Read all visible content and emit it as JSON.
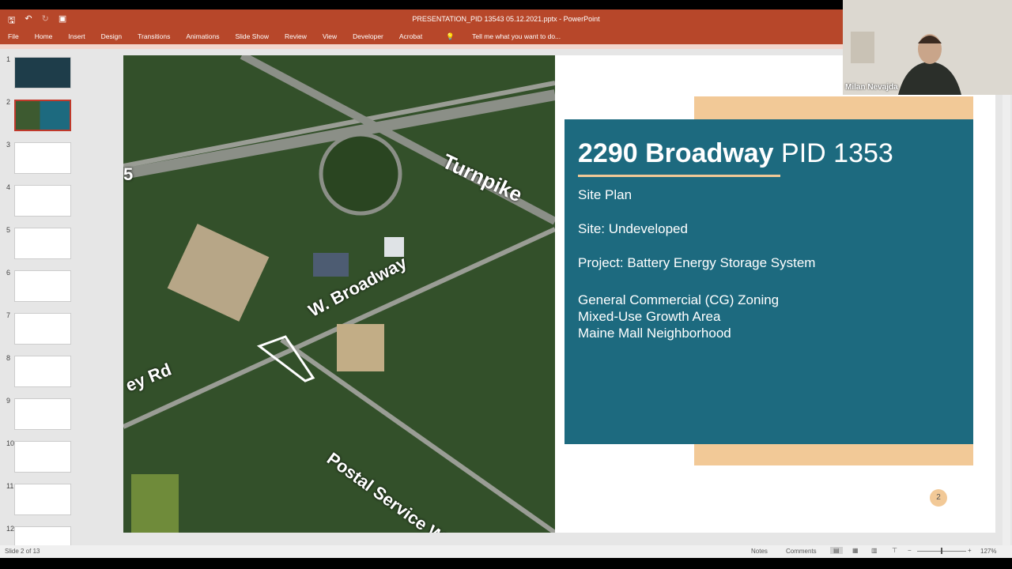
{
  "app": {
    "title": "PRESENTATION_PID 13543 05.12.2021.pptx - PowerPoint"
  },
  "ribbon": {
    "tabs": [
      "File",
      "Home",
      "Insert",
      "Design",
      "Transitions",
      "Animations",
      "Slide Show",
      "Review",
      "View",
      "Developer",
      "Acrobat"
    ],
    "tell_me": "Tell me what you want to do..."
  },
  "thumbnails": [
    "1",
    "2",
    "3",
    "4",
    "5",
    "6",
    "7",
    "8",
    "9",
    "10",
    "11",
    "12"
  ],
  "slide": {
    "map_labels": {
      "turnpike": "Turnpike",
      "broadway": "W. Broadway",
      "rd": "ey Rd",
      "postal": "Postal Service Way",
      "five": "5"
    },
    "title_bold": "2290 Broadway",
    "title_thin": "PID 1353",
    "lines": [
      "Site Plan",
      "Site: Undeveloped",
      "Project: Battery Energy Storage System",
      "General Commercial (CG) Zoning",
      "Mixed-Use Growth Area",
      "Maine Mall Neighborhood"
    ],
    "page_number": "2"
  },
  "webcam": {
    "name": "Milan Nevajda"
  },
  "status": {
    "slide_of": "Slide 2 of 13",
    "notes": "Notes",
    "comments": "Comments",
    "zoom": "127%"
  },
  "colors": {
    "ribbon": "#b7472a",
    "teal": "#1d6a7f",
    "tan": "#f2c997"
  }
}
